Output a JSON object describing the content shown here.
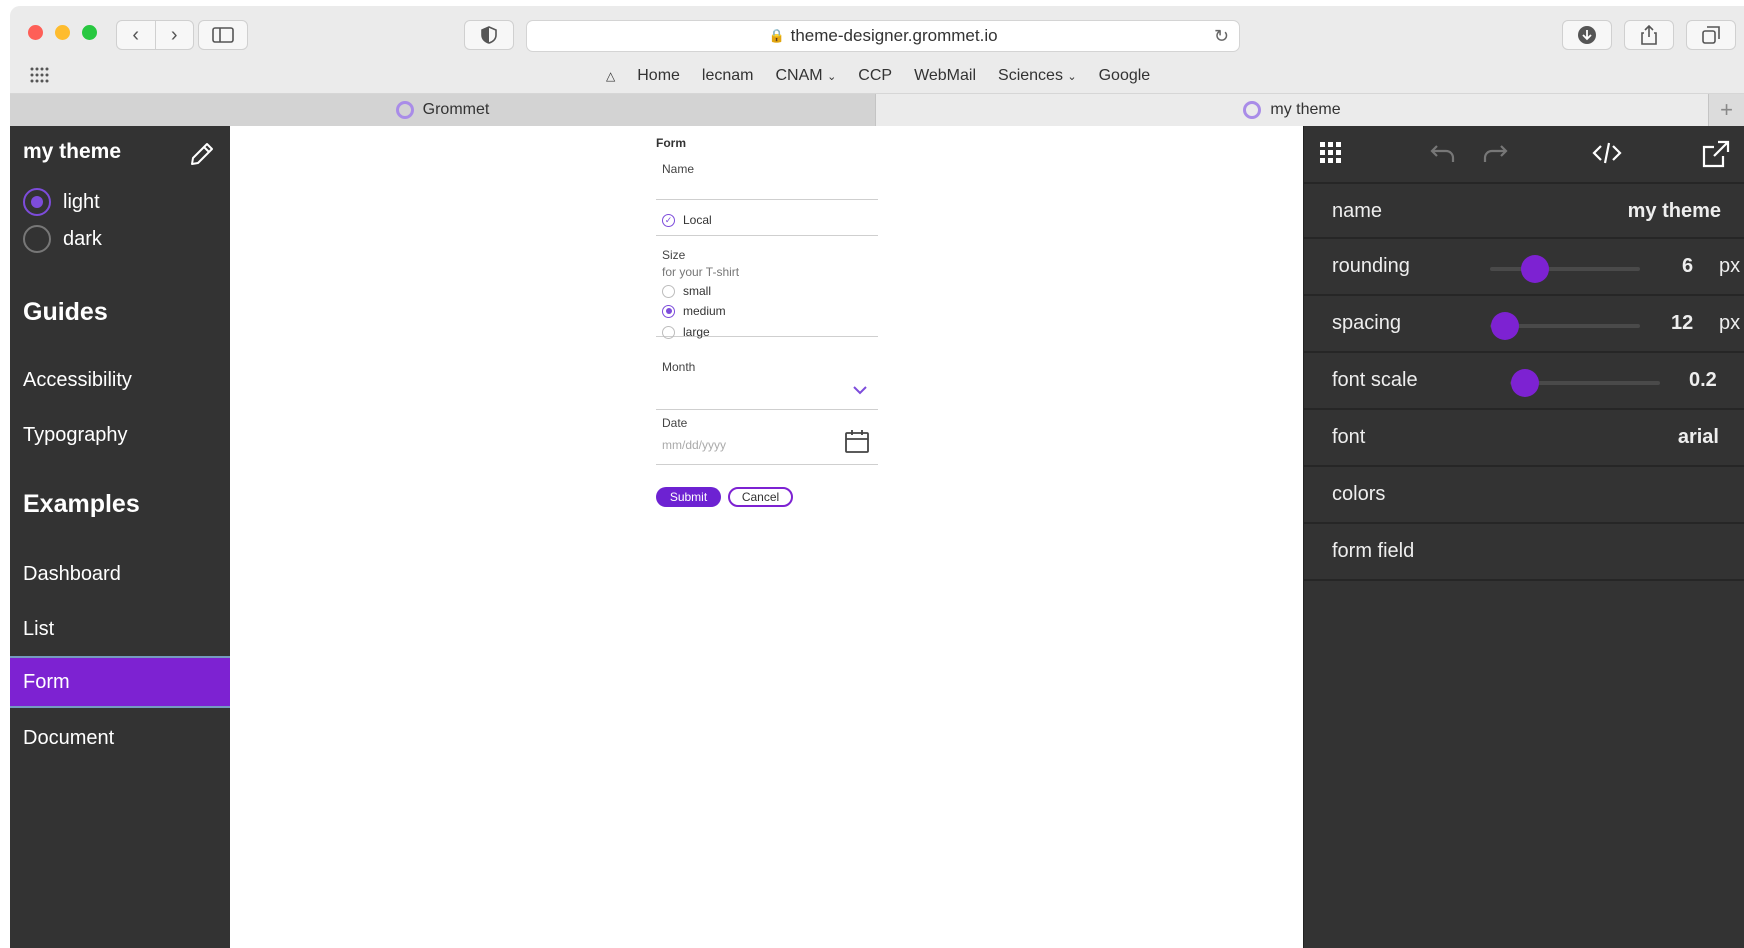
{
  "browser": {
    "url": "theme-designer.grommet.io",
    "bookmarks": [
      "Home",
      "lecnam",
      "CNAM",
      "CCP",
      "WebMail",
      "Sciences",
      "Google"
    ],
    "tabs": [
      {
        "label": "Grommet",
        "active": false
      },
      {
        "label": "my theme",
        "active": true
      }
    ]
  },
  "sidebar": {
    "title": "my theme",
    "modes": [
      {
        "label": "light",
        "selected": true
      },
      {
        "label": "dark",
        "selected": false
      }
    ],
    "guides_heading": "Guides",
    "guides": [
      "Accessibility",
      "Typography"
    ],
    "examples_heading": "Examples",
    "examples": [
      "Dashboard",
      "List",
      "Form",
      "Document"
    ],
    "active_item": "Form"
  },
  "form": {
    "title": "Form",
    "name_label": "Name",
    "local_label": "Local",
    "size_label": "Size",
    "size_help": "for your T-shirt",
    "size_options": [
      {
        "label": "small",
        "selected": false
      },
      {
        "label": "medium",
        "selected": true
      },
      {
        "label": "large",
        "selected": false
      }
    ],
    "month_label": "Month",
    "date_label": "Date",
    "date_placeholder": "mm/dd/yyyy",
    "submit_label": "Submit",
    "cancel_label": "Cancel"
  },
  "panel": {
    "name_label": "name",
    "name_value": "my theme",
    "rounding_label": "rounding",
    "rounding_value": "6",
    "rounding_unit": "px",
    "rounding_level": 0.3,
    "spacing_label": "spacing",
    "spacing_value": "12",
    "spacing_unit": "px",
    "spacing_level": 0.1,
    "font_scale_label": "font scale",
    "font_scale_value": "0.2",
    "font_scale_level": 0.1,
    "font_label": "font",
    "font_value": "arial",
    "colors_label": "colors",
    "form_field_label": "form field"
  },
  "colors": {
    "accent": "#7d22d2",
    "sidebar_bg": "#333333",
    "active_border": "#6fffb0"
  },
  "icons": [
    "pencil-icon",
    "grid-icon",
    "undo-icon",
    "redo-icon",
    "code-icon",
    "share-icon",
    "calendar-icon",
    "chevron-down-icon"
  ]
}
